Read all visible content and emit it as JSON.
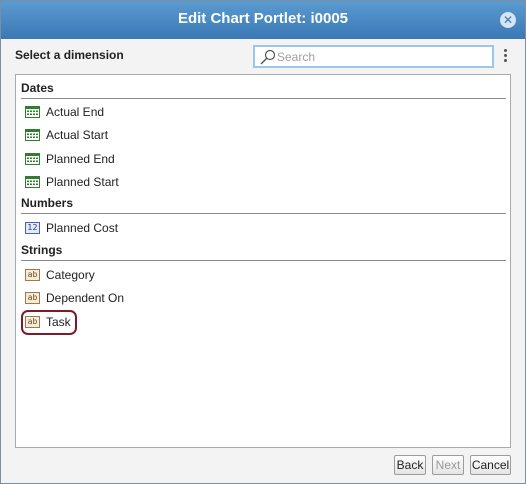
{
  "dialog": {
    "title": "Edit Chart Portlet: i0005",
    "close_icon": "close-icon",
    "prompt": "Select a dimension"
  },
  "search": {
    "placeholder": "Search",
    "value": "",
    "icon": "search-icon"
  },
  "menu_icon": "more-vertical-icon",
  "groups": [
    {
      "label": "Dates",
      "icon": "calendar-icon",
      "items": [
        {
          "label": "Actual End"
        },
        {
          "label": "Actual Start"
        },
        {
          "label": "Planned End"
        },
        {
          "label": "Planned Start"
        }
      ]
    },
    {
      "label": "Numbers",
      "icon": "number-icon",
      "icon_text": "12",
      "items": [
        {
          "label": "Planned Cost"
        }
      ]
    },
    {
      "label": "Strings",
      "icon": "text-icon",
      "icon_text": "ab",
      "items": [
        {
          "label": "Category"
        },
        {
          "label": "Dependent On"
        },
        {
          "label": "Task",
          "selected": true
        }
      ]
    }
  ],
  "buttons": {
    "back": "Back",
    "next": "Next",
    "next_disabled": true,
    "cancel": "Cancel"
  },
  "colors": {
    "titlebar": "#4a8ac4",
    "selection_ring": "#7b1c2c",
    "date_icon": "#2f7d2f"
  }
}
